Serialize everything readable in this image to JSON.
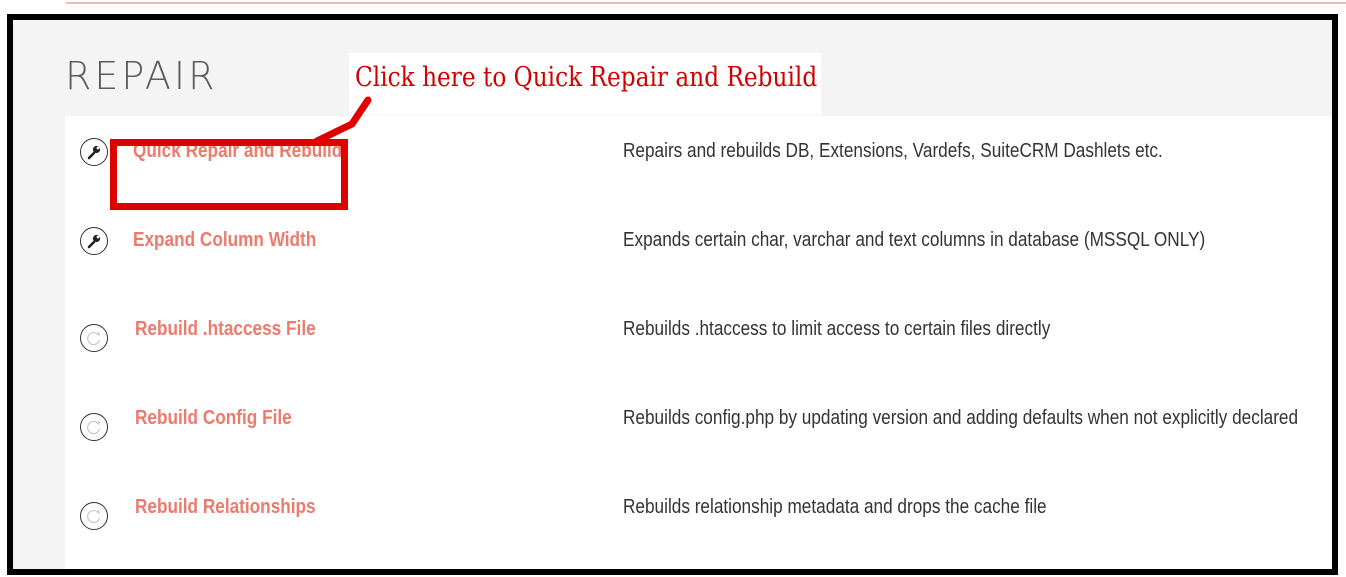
{
  "panel": {
    "title": "REPAIR"
  },
  "annotation": {
    "text": "Click here to Quick Repair and Rebuild",
    "color": "#e00000"
  },
  "repair_items": [
    {
      "label": "Quick Repair and Rebuild",
      "description": "Repairs and rebuilds DB, Extensions, Vardefs, SuiteCRM Dashlets etc.",
      "icon": "wrench-icon"
    },
    {
      "label": "Expand Column Width",
      "description": "Expands certain char, varchar and text columns in database (MSSQL ONLY)",
      "icon": "wrench-icon"
    },
    {
      "label": "Rebuild .htaccess File",
      "description": "Rebuilds .htaccess to limit access to certain files directly",
      "icon": "refresh-icon"
    },
    {
      "label": "Rebuild Config File",
      "description": "Rebuilds config.php by updating version and adding defaults when not explicitly declared",
      "icon": "refresh-icon"
    },
    {
      "label": "Rebuild Relationships",
      "description": "Rebuilds relationship metadata and drops the cache file",
      "icon": "refresh-icon"
    }
  ],
  "colors": {
    "link": "#ec7a6d",
    "frame_border": "#000000",
    "header_background": "#f4f4f4"
  }
}
